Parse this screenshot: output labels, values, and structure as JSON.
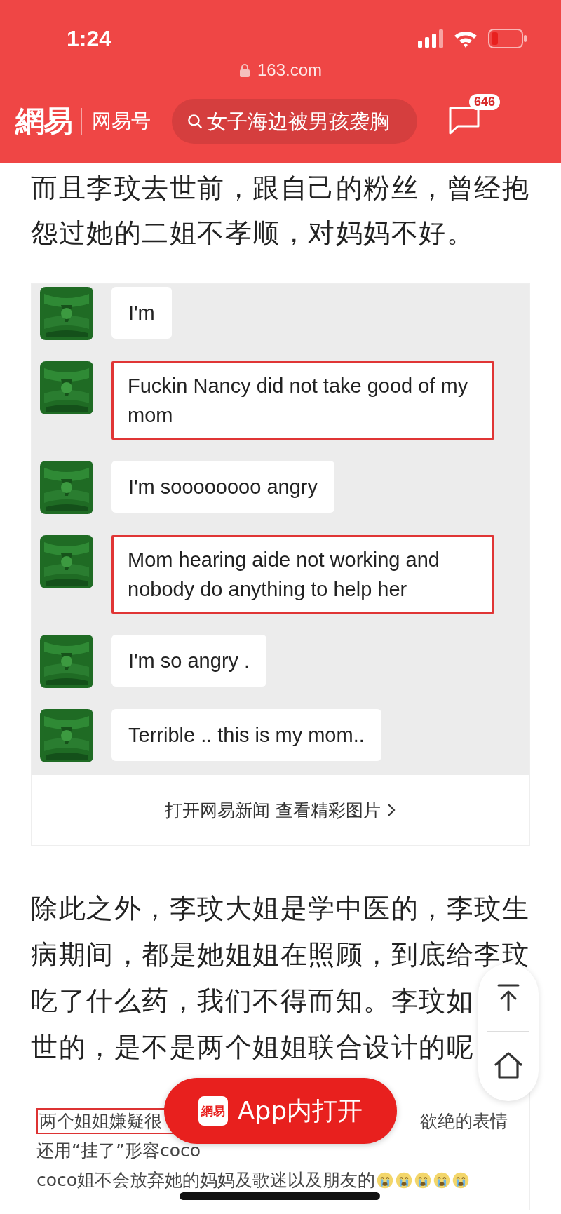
{
  "status_bar": {
    "time": "1:24"
  },
  "address_bar": {
    "url": "163.com"
  },
  "header": {
    "logo": "網易",
    "channel": "网易号",
    "search": {
      "placeholder": "女子海边被男孩袭胸"
    },
    "messages_badge": "646"
  },
  "paragraph_1": "而且李玟去世前，跟自己的粉丝，曾经抱怨过她的二姐不孝顺，对妈妈不好。",
  "chat_image": {
    "messages": [
      {
        "text": "I'm",
        "highlighted": false
      },
      {
        "text": "Fuckin Nancy did not take good of my mom",
        "highlighted": true
      },
      {
        "text": "I'm soooooooo angry",
        "highlighted": false
      },
      {
        "text": "Mom hearing aide not working and nobody do anything to help her",
        "highlighted": true
      },
      {
        "text": "I'm so angry .",
        "highlighted": false
      },
      {
        "text": "Terrible .. this is my mom..",
        "highlighted": false
      }
    ]
  },
  "image_caption": "打开网易新闻 查看精彩图片",
  "paragraph_2": [
    "除此之外，李玟大姐是学中医的，李玟生",
    "病期间，都是她姐姐在照顾，到底给李玟",
    "吃了什么药，我们不得而知。李玟如",
    "世的，是不是两个姐姐联合设计的呢"
  ],
  "embedded_screenshot": {
    "lines": [
      {
        "parts": [
          "两个姐姐嫌疑很",
          "欲绝的表情"
        ],
        "boxed": true
      },
      {
        "parts": [
          "还用“挂了”形容coco"
        ],
        "boxed": false
      },
      {
        "parts": [
          "coco姐不会放弃她的妈妈及歌迷以及朋友的"
        ],
        "boxed": false,
        "emojis": [
          {
            "kind": "crying"
          },
          {
            "kind": "crying"
          },
          {
            "kind": "crying"
          },
          {
            "kind": "crying"
          },
          {
            "kind": "crying"
          }
        ]
      }
    ]
  },
  "open_in_app": {
    "logo": "網易",
    "label": "App内打开"
  }
}
